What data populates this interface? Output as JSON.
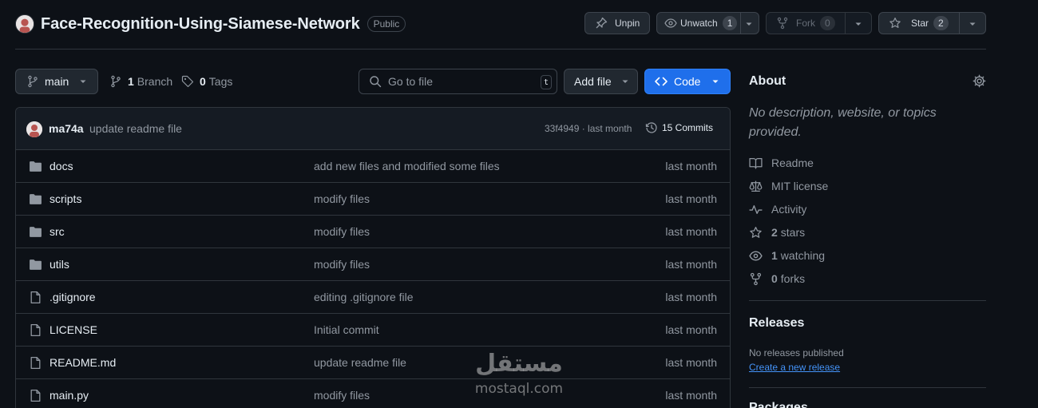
{
  "repo": {
    "name": "Face-Recognition-Using-Siamese-Network",
    "visibility": "Public"
  },
  "header_actions": {
    "unpin": "Unpin",
    "watch": "Unwatch",
    "watch_count": "1",
    "fork": "Fork",
    "fork_count": "0",
    "star": "Star",
    "star_count": "2"
  },
  "toolbar": {
    "branch": "main",
    "branch_count": "1",
    "branch_label": "Branch",
    "tag_count": "0",
    "tag_label": "Tags",
    "search_placeholder": "Go to file",
    "search_shortcut": "t",
    "add_file": "Add file",
    "code": "Code"
  },
  "latest_commit": {
    "author": "ma74a",
    "message": "update readme file",
    "hash_and_time": "33f4949 · last month",
    "commits_label": "15 Commits"
  },
  "files": [
    {
      "name": "docs",
      "type": "folder",
      "message": "add new files and modified some files",
      "date": "last month"
    },
    {
      "name": "scripts",
      "type": "folder",
      "message": "modify files",
      "date": "last month"
    },
    {
      "name": "src",
      "type": "folder",
      "message": "modify files",
      "date": "last month"
    },
    {
      "name": "utils",
      "type": "folder",
      "message": "modify files",
      "date": "last month"
    },
    {
      "name": ".gitignore",
      "type": "file",
      "message": "editing .gitignore file",
      "date": "last month"
    },
    {
      "name": "LICENSE",
      "type": "file",
      "message": "Initial commit",
      "date": "last month"
    },
    {
      "name": "README.md",
      "type": "file",
      "message": "update readme file",
      "date": "last month"
    },
    {
      "name": "main.py",
      "type": "file",
      "message": "modify files",
      "date": "last month"
    }
  ],
  "about": {
    "title": "About",
    "description": "No description, website, or topics provided.",
    "readme": "Readme",
    "license": "MIT license",
    "activity": "Activity",
    "stars_count": "2",
    "stars_label": "stars",
    "watching_count": "1",
    "watching_label": "watching",
    "forks_count": "0",
    "forks_label": "forks"
  },
  "releases": {
    "title": "Releases",
    "none_text": "No releases published",
    "create_link": "Create a new release"
  },
  "packages": {
    "title": "Packages"
  },
  "watermark": {
    "arabic": "مستقل",
    "latin": "mostaql.com"
  },
  "colors": {
    "background": "#0d1117",
    "accent_blue": "#1f6feb",
    "link": "#4493f8",
    "border": "#30363d",
    "muted_text": "#9198a1"
  }
}
